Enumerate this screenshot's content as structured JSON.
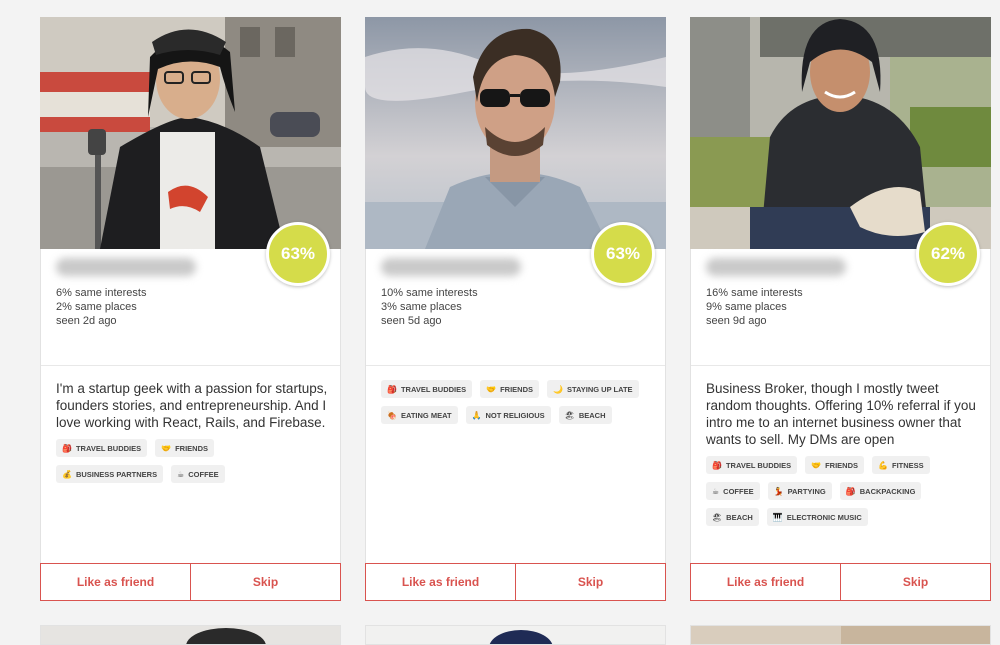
{
  "cards": [
    {
      "match": "63%",
      "interests": "6% same interests",
      "places": "2% same places",
      "seen": "seen 2d ago",
      "bio": "I'm a startup geek with a passion for startups, founders stories, and entrepreneurship. And I love working with React, Rails, and Firebase.",
      "tags": [
        {
          "icon": "🎒",
          "label": "TRAVEL BUDDIES"
        },
        {
          "icon": "🤝",
          "label": "FRIENDS"
        },
        {
          "icon": "💰",
          "label": "BUSINESS PARTNERS"
        },
        {
          "icon": "☕",
          "label": "COFFEE"
        }
      ],
      "like_label": "Like as friend",
      "skip_label": "Skip"
    },
    {
      "match": "63%",
      "interests": "10% same interests",
      "places": "3% same places",
      "seen": "seen 5d ago",
      "bio": "",
      "tags": [
        {
          "icon": "🎒",
          "label": "TRAVEL BUDDIES"
        },
        {
          "icon": "🤝",
          "label": "FRIENDS"
        },
        {
          "icon": "🌙",
          "label": "STAYING UP LATE"
        },
        {
          "icon": "🍖",
          "label": "EATING MEAT"
        },
        {
          "icon": "🙏",
          "label": "NOT RELIGIOUS"
        },
        {
          "icon": "🏖",
          "label": "BEACH"
        }
      ],
      "like_label": "Like as friend",
      "skip_label": "Skip"
    },
    {
      "match": "62%",
      "interests": "16% same interests",
      "places": "9% same places",
      "seen": "seen 9d ago",
      "bio": "Business Broker, though I mostly tweet random thoughts. Offering 10% referral if you intro me to an internet business owner that wants to sell. My DMs are open",
      "tags": [
        {
          "icon": "🎒",
          "label": "TRAVEL BUDDIES"
        },
        {
          "icon": "🤝",
          "label": "FRIENDS"
        },
        {
          "icon": "💪",
          "label": "FITNESS"
        },
        {
          "icon": "☕",
          "label": "COFFEE"
        },
        {
          "icon": "💃",
          "label": "PARTYING"
        },
        {
          "icon": "🎒",
          "label": "BACKPACKING"
        },
        {
          "icon": "🏖",
          "label": "BEACH"
        },
        {
          "icon": "🎹",
          "label": "ELECTRONIC MUSIC"
        }
      ],
      "like_label": "Like as friend",
      "skip_label": "Skip"
    }
  ]
}
